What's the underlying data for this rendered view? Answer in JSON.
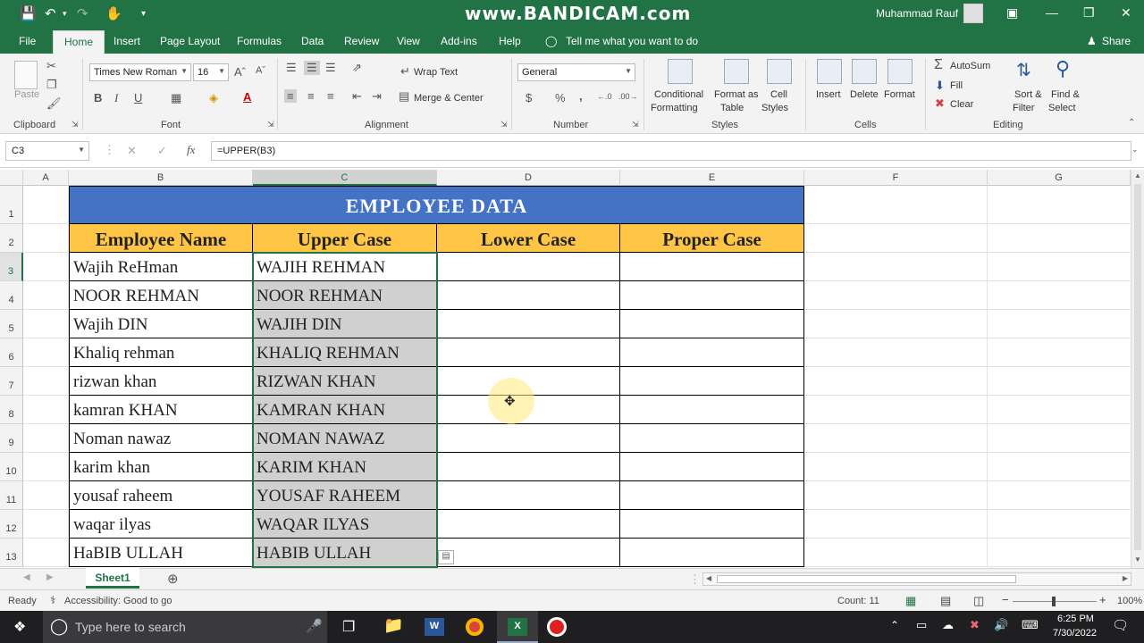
{
  "titlebar": {
    "watermark": "www.BANDICAM.com",
    "user": "Muhammad Rauf"
  },
  "tabs": [
    "File",
    "Home",
    "Insert",
    "Page Layout",
    "Formulas",
    "Data",
    "Review",
    "View",
    "Add-ins",
    "Help"
  ],
  "tell_me": "Tell me what you want to do",
  "share": "Share",
  "ribbon": {
    "clipboard": {
      "paste": "Paste",
      "group": "Clipboard"
    },
    "font": {
      "name": "Times New Roman",
      "size": "16",
      "group": "Font",
      "bold": "B",
      "italic": "I",
      "underline": "U"
    },
    "alignment": {
      "wrap": "Wrap Text",
      "merge": "Merge & Center",
      "group": "Alignment"
    },
    "number": {
      "format": "General",
      "currency": "$",
      "percent": "%",
      "comma": ",",
      "group": "Number"
    },
    "styles": {
      "cond1": "Conditional",
      "cond2": "Formatting",
      "fmt1": "Format as",
      "fmt2": "Table",
      "cs1": "Cell",
      "cs2": "Styles",
      "group": "Styles"
    },
    "cells": {
      "insert": "Insert",
      "delete": "Delete",
      "format": "Format",
      "group": "Cells"
    },
    "editing": {
      "autosum": "AutoSum",
      "fill": "Fill",
      "clear": "Clear",
      "sort1": "Sort &",
      "sort2": "Filter",
      "find1": "Find &",
      "find2": "Select",
      "group": "Editing"
    }
  },
  "formula_bar": {
    "name_box": "C3",
    "fx": "fx",
    "formula": "=UPPER(B3)"
  },
  "columns": [
    "A",
    "B",
    "C",
    "D",
    "E",
    "F",
    "G"
  ],
  "rows": [
    "1",
    "2",
    "3",
    "4",
    "5",
    "6",
    "7",
    "8",
    "9",
    "10",
    "11",
    "12",
    "13"
  ],
  "sheet": {
    "title": "EMPLOYEE DATA",
    "headers": [
      "Employee Name",
      "Upper Case",
      "Lower Case",
      "Proper Case"
    ],
    "data": [
      [
        "Wajih ReHman",
        "WAJIH REHMAN"
      ],
      [
        "NOOR REHMAN",
        "NOOR REHMAN"
      ],
      [
        "Wajih DIN",
        "WAJIH DIN"
      ],
      [
        "Khaliq rehman",
        "KHALIQ REHMAN"
      ],
      [
        "rizwan khan",
        "RIZWAN KHAN"
      ],
      [
        "kamran KHAN",
        "KAMRAN KHAN"
      ],
      [
        "Noman nawaz",
        "NOMAN NAWAZ"
      ],
      [
        "karim khan",
        "KARIM KHAN"
      ],
      [
        "yousaf raheem",
        "YOUSAF RAHEEM"
      ],
      [
        "waqar ilyas",
        "WAQAR ILYAS"
      ],
      [
        "HaBIB ULLAH",
        "HABIB ULLAH"
      ]
    ]
  },
  "sheet_tab": "Sheet1",
  "status": {
    "ready": "Ready",
    "accessibility": "Accessibility: Good to go",
    "count": "Count: 11",
    "zoom": "100%"
  },
  "taskbar": {
    "search": "Type here to search",
    "time": "6:25 PM",
    "date": "7/30/2022"
  },
  "colors": {
    "excel_green": "#217346",
    "title_fill": "#4472c4",
    "header_fill": "#ffc646",
    "selection_fill": "#d0d0d0"
  }
}
